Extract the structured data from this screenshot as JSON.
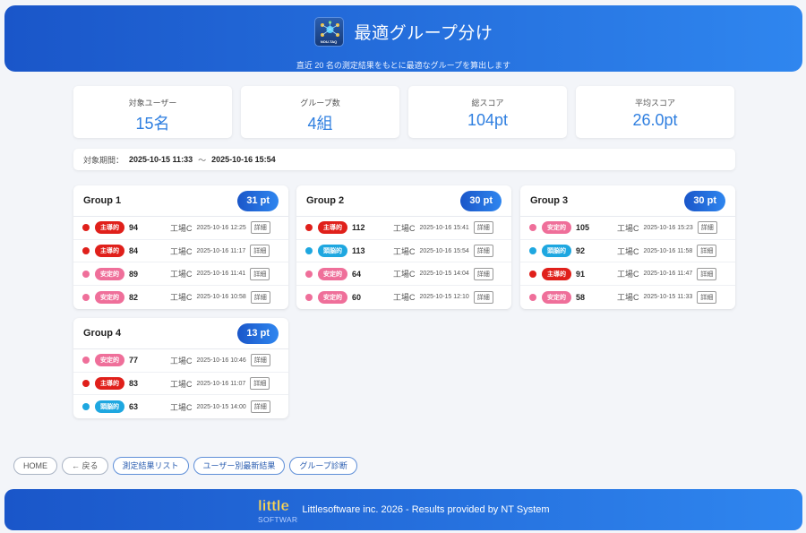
{
  "header": {
    "logo_text": "NOU-TAQ",
    "title": "最適グループ分け",
    "subtitle": "直近 20 名の測定結果をもとに最適なグループを算出します"
  },
  "stats": [
    {
      "label": "対象ユーザー",
      "value": "15名"
    },
    {
      "label": "グループ数",
      "value": "4組"
    },
    {
      "label": "総スコア",
      "value": "104pt"
    },
    {
      "label": "平均スコア",
      "value": "26.0pt"
    }
  ],
  "period": {
    "label": "対象期間：",
    "start": "2025-10-15 11:33",
    "separator": "～",
    "end": "2025-10-16 15:54"
  },
  "type_colors": {
    "主導的": "#e0201b",
    "安定的": "#ef6f9a",
    "頭脳的": "#1ea7e0"
  },
  "groups": [
    {
      "name": "Group 1",
      "points": "31 pt",
      "members": [
        {
          "type": "主導的",
          "score": "94",
          "site": "工場C",
          "time": "2025-10-16 12:25",
          "detail": "詳細"
        },
        {
          "type": "主導的",
          "score": "84",
          "site": "工場C",
          "time": "2025-10-16 11:17",
          "detail": "詳細"
        },
        {
          "type": "安定的",
          "score": "89",
          "site": "工場C",
          "time": "2025-10-16 11:41",
          "detail": "詳細"
        },
        {
          "type": "安定的",
          "score": "82",
          "site": "工場C",
          "time": "2025-10-16 10:58",
          "detail": "詳細"
        }
      ]
    },
    {
      "name": "Group 2",
      "points": "30 pt",
      "members": [
        {
          "type": "主導的",
          "score": "112",
          "site": "工場C",
          "time": "2025-10-16 15:41",
          "detail": "詳細"
        },
        {
          "type": "頭脳的",
          "score": "113",
          "site": "工場C",
          "time": "2025-10-16 15:54",
          "detail": "詳細"
        },
        {
          "type": "安定的",
          "score": "64",
          "site": "工場C",
          "time": "2025-10-15 14:04",
          "detail": "詳細"
        },
        {
          "type": "安定的",
          "score": "60",
          "site": "工場C",
          "time": "2025-10-15 12:10",
          "detail": "詳細"
        }
      ]
    },
    {
      "name": "Group 3",
      "points": "30 pt",
      "members": [
        {
          "type": "安定的",
          "score": "105",
          "site": "工場C",
          "time": "2025-10-16 15:23",
          "detail": "詳細"
        },
        {
          "type": "頭脳的",
          "score": "92",
          "site": "工場C",
          "time": "2025-10-16 11:58",
          "detail": "詳細"
        },
        {
          "type": "主導的",
          "score": "91",
          "site": "工場C",
          "time": "2025-10-16 11:47",
          "detail": "詳細"
        },
        {
          "type": "安定的",
          "score": "58",
          "site": "工場C",
          "time": "2025-10-15 11:33",
          "detail": "詳細"
        }
      ]
    },
    {
      "name": "Group 4",
      "points": "13 pt",
      "members": [
        {
          "type": "安定的",
          "score": "77",
          "site": "工場C",
          "time": "2025-10-16 10:46",
          "detail": "詳細"
        },
        {
          "type": "主導的",
          "score": "83",
          "site": "工場C",
          "time": "2025-10-16 11:07",
          "detail": "詳細"
        },
        {
          "type": "頭脳的",
          "score": "63",
          "site": "工場C",
          "time": "2025-10-15 14:00",
          "detail": "詳細"
        }
      ]
    }
  ],
  "nav": [
    {
      "label": "HOME",
      "style": "plain"
    },
    {
      "label": "← 戻る",
      "style": "plain"
    },
    {
      "label": "測定結果リスト",
      "style": "blue"
    },
    {
      "label": "ユーザー別最新結果",
      "style": "blue"
    },
    {
      "label": "グループ診断",
      "style": "blue"
    }
  ],
  "footer": {
    "logo_word": "little",
    "logo_sub": "SOFTWARE",
    "text": "Littlesoftware inc. 2026 - Results provided by NT System"
  }
}
